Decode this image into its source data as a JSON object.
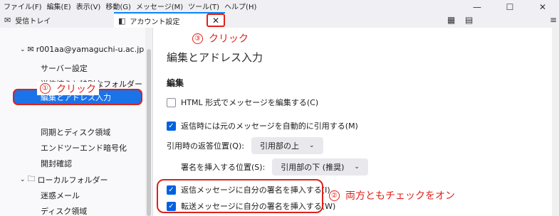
{
  "menubar": {
    "items": [
      "ファイル(F)",
      "編集(E)",
      "表示(V)",
      "移動(G)",
      "メッセージ(M)",
      "ツール(T)",
      "ヘルプ(H)"
    ]
  },
  "window_controls": {
    "minimize": "—",
    "maximize": "☐",
    "close": "✕"
  },
  "tabs": {
    "inbox": "受信トレイ",
    "account": "アカウント設定",
    "close": "✕"
  },
  "sidebar": {
    "account_email": "r001aa@yamaguchi-u.ac.jp",
    "items": [
      "サーバー設定",
      "送信控えと特別なフォルダー",
      "編集とアドレス入力",
      "同期とディスク領域",
      "エンドツーエンド暗号化",
      "開封確認"
    ],
    "local_folders": "ローカルフォルダー",
    "local_items": [
      "迷惑メール",
      "ディスク領域"
    ]
  },
  "annotations": {
    "step1_num": "①",
    "step1_text": "クリック",
    "step2_num": "②",
    "step2_text": "両方ともチェックをオン",
    "step3_num": "③",
    "step3_text": "クリック"
  },
  "main": {
    "page_title": "編集とアドレス入力",
    "section_title": "編集",
    "html_compose": "HTML 形式でメッセージを編集する(C)",
    "html_compose_checked": false,
    "quote_reply": "返信時には元のメッセージを自動的に引用する(M)",
    "quote_reply_checked": true,
    "reply_position_label": "引用時の返答位置(Q):",
    "reply_position_value": "引用部の上",
    "signature_position_label": "署名を挿入する位置(S):",
    "signature_position_value": "引用部の下 (推奨)",
    "sig_on_reply": "返信メッセージに自分の署名を挿入する(I)",
    "sig_on_reply_checked": true,
    "sig_on_forward": "転送メッセージに自分の署名を挿入する(W)",
    "sig_on_forward_checked": true
  },
  "colors": {
    "accent": "#1a73e8",
    "annotation": "#e0201a",
    "checkbox": "#0061e0"
  }
}
